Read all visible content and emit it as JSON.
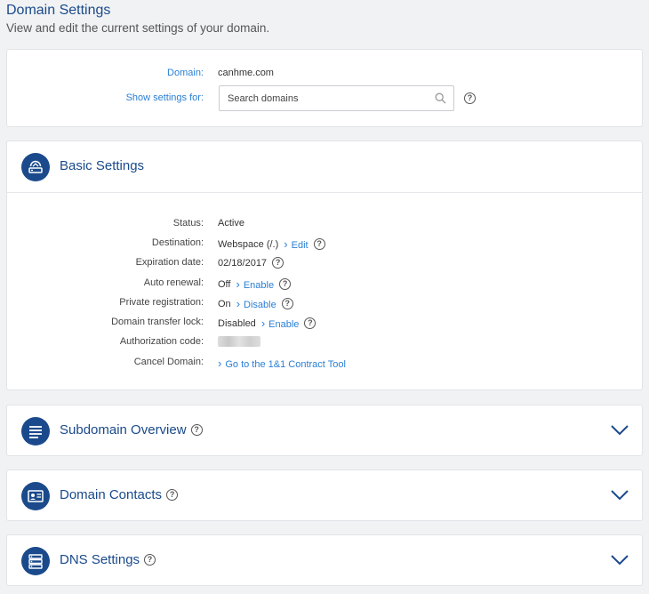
{
  "header": {
    "title": "Domain Settings",
    "subtitle": "View and edit the current settings of your domain."
  },
  "domain_box": {
    "domain_label": "Domain:",
    "domain_value": "canhme.com",
    "show_settings_label": "Show settings for:",
    "search_placeholder": "Search domains"
  },
  "basic": {
    "title": "Basic Settings",
    "rows": [
      {
        "label": "Status:",
        "value": "Active"
      },
      {
        "label": "Destination:",
        "value": "Webspace (/.)",
        "link": "Edit"
      },
      {
        "label": "Expiration date:",
        "value": "02/18/2017"
      },
      {
        "label": "Auto renewal:",
        "value": "Off",
        "link": "Enable"
      },
      {
        "label": "Private registration:",
        "value": "On",
        "link": "Disable"
      },
      {
        "label": "Domain transfer lock:",
        "value": "Disabled",
        "link": "Enable"
      },
      {
        "label": "Authorization code:",
        "value": ""
      },
      {
        "label": "Cancel Domain:",
        "link": "Go to the 1&1 Contract Tool"
      }
    ]
  },
  "sections": {
    "subdomain": "Subdomain Overview",
    "contacts": "Domain Contacts",
    "dns": "DNS Settings"
  },
  "icons": {
    "help": "help-circle-icon",
    "chevron": "chevron-down-icon",
    "search": "search-icon"
  },
  "colors": {
    "accent": "#1b4a8c",
    "link": "#2a7fd4"
  }
}
